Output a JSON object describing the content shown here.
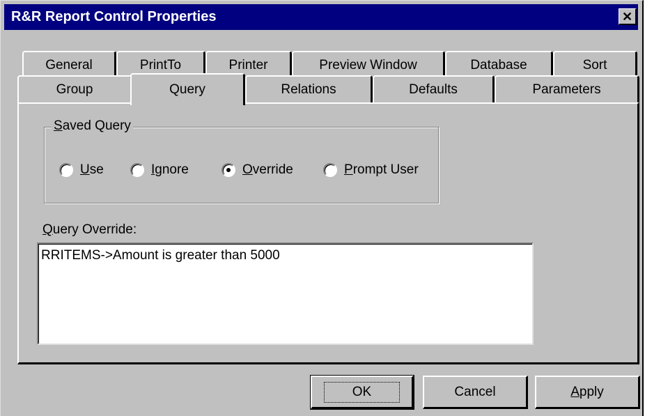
{
  "window": {
    "title": "R&R Report Control Properties",
    "close_glyph": "✕"
  },
  "tabs": {
    "row1": [
      "General",
      "PrintTo",
      "Printer",
      "Preview Window",
      "Database",
      "Sort"
    ],
    "row2": [
      "Group",
      "Query",
      "Relations",
      "Defaults",
      "Parameters"
    ],
    "active": "Query"
  },
  "saved_query": {
    "legend_hotkey": "S",
    "legend_rest": "aved Query",
    "options": [
      {
        "hotkey": "U",
        "rest": "se",
        "selected": false
      },
      {
        "hotkey": "I",
        "rest": "gnore",
        "selected": false
      },
      {
        "hotkey": "O",
        "rest": "verride",
        "selected": true
      },
      {
        "hotkey": "P",
        "rest": "rompt User",
        "selected": false
      }
    ]
  },
  "query_override": {
    "label_hotkey": "Q",
    "label_rest": "uery Override:",
    "value": "RRITEMS->Amount is greater than 5000"
  },
  "buttons": {
    "ok": "OK",
    "cancel": "Cancel",
    "apply_hotkey": "A",
    "apply_rest": "pply"
  },
  "colors": {
    "title_bar": "#000080",
    "face": "#c0c0c0"
  }
}
